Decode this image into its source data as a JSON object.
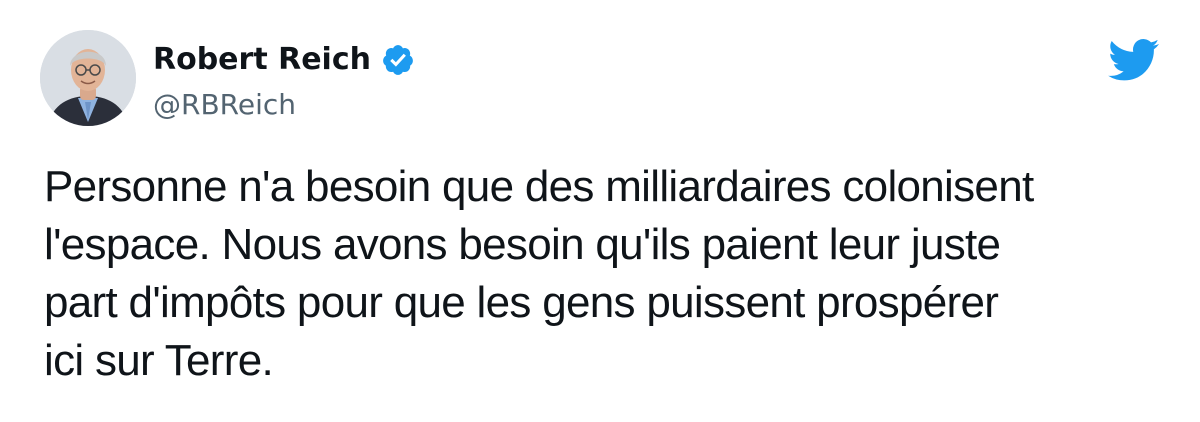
{
  "tweet": {
    "author": {
      "name": "Robert Reich",
      "handle": "@RBReich",
      "verified": true,
      "avatar_icon": "profile-photo"
    },
    "brand_icon": "twitter-bird-icon",
    "brand_color": "#1d9bf0",
    "text_lines": [
      "Personne n'a besoin que des milliardaires colonisent",
      "l'espace. Nous avons besoin qu'ils paient leur juste",
      "part d'impôts pour que les gens puissent prospérer",
      "ici sur Terre."
    ]
  }
}
